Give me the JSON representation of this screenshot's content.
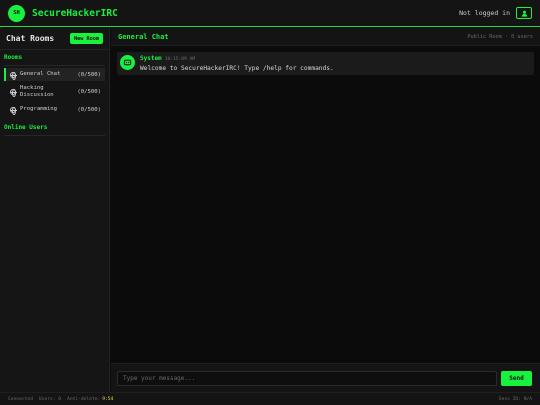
{
  "header": {
    "logo_text": "SH",
    "app_title": "SecureHackerIRC",
    "auth_status": "Not logged in",
    "user_icon": "user-icon"
  },
  "sidebar": {
    "title": "Chat Rooms",
    "new_room_label": "New Room",
    "rooms_label": "Rooms",
    "rooms": [
      {
        "name": "General Chat",
        "count": "(0/500)",
        "active": true
      },
      {
        "name": "Hacking Discussion",
        "count": "(0/500)",
        "active": false
      },
      {
        "name": "Programming",
        "count": "(0/500)",
        "active": false
      }
    ],
    "online_label": "Online Users"
  },
  "chat": {
    "room_title": "General Chat",
    "room_meta": "Public Room · 0 users",
    "messages": [
      {
        "sender": "System",
        "time": "10:15:09 AM",
        "text": "Welcome to SecureHackerIRC! Type /help for commands."
      }
    ],
    "input_placeholder": "Type your message...",
    "send_label": "Send"
  },
  "status": {
    "connection": "Connected",
    "users": "Users: 0",
    "anon_label": "Anti-delete:",
    "anon_value": "9:54",
    "session": "Sess ID: N/A"
  },
  "colors": {
    "accent": "#19f23f",
    "bg": "#0d0d0d",
    "panel": "#141414",
    "warn": "#e8e04a"
  }
}
